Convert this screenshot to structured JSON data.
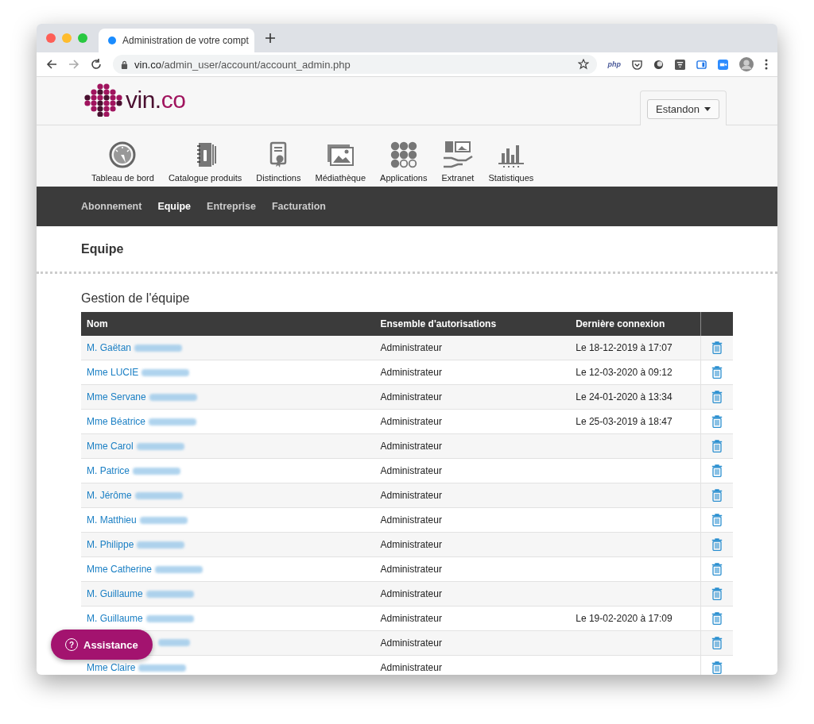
{
  "browser": {
    "tab_title": "Administration de votre compt",
    "url_host": "vin.co",
    "url_path": "/admin_user/account/account_admin.php",
    "extension_label": "php"
  },
  "header": {
    "logo_text": "vin.",
    "logo_accent": "co",
    "user_menu": "Estandon"
  },
  "modules": [
    {
      "label": "Tableau de bord",
      "kind": "gauge"
    },
    {
      "label": "Catalogue produits",
      "kind": "catalog"
    },
    {
      "label": "Distinctions",
      "kind": "award"
    },
    {
      "label": "Médiathèque",
      "kind": "images"
    },
    {
      "label": "Applications",
      "kind": "grid"
    },
    {
      "label": "Extranet",
      "kind": "hand"
    },
    {
      "label": "Statistiques",
      "kind": "chart"
    }
  ],
  "subnav": [
    {
      "label": "Abonnement",
      "selected": false
    },
    {
      "label": "Equipe",
      "selected": true
    },
    {
      "label": "Entreprise",
      "selected": false
    },
    {
      "label": "Facturation",
      "selected": false
    }
  ],
  "page_title": "Equipe",
  "section_title": "Gestion de l'équipe",
  "table": {
    "columns": [
      "Nom",
      "Ensemble d'autorisations",
      "Dernière connexion"
    ],
    "rows": [
      {
        "name": "M. Gaëtan",
        "surname_blurred": true,
        "role": "Administrateur",
        "last_login": "Le 18-12-2019 à 17:07"
      },
      {
        "name": "Mme LUCIE",
        "surname_blurred": true,
        "role": "Administrateur",
        "last_login": "Le 12-03-2020 à 09:12"
      },
      {
        "name": "Mme Servane",
        "surname_blurred": true,
        "role": "Administrateur",
        "last_login": "Le 24-01-2020 à 13:34"
      },
      {
        "name": "Mme Béatrice",
        "surname_blurred": true,
        "role": "Administrateur",
        "last_login": "Le 25-03-2019 à 18:47"
      },
      {
        "name": "Mme Carol",
        "surname_blurred": true,
        "role": "Administrateur"
      },
      {
        "name": "M. Patrice",
        "surname_blurred": true,
        "role": "Administrateur"
      },
      {
        "name": "M. Jérôme",
        "surname_blurred": true,
        "role": "Administrateur"
      },
      {
        "name": "M. Matthieu",
        "surname_blurred": true,
        "role": "Administrateur"
      },
      {
        "name": "M. Philippe",
        "surname_blurred": true,
        "role": "Administrateur"
      },
      {
        "name": "Mme Catherine",
        "surname_blurred": true,
        "role": "Administrateur"
      },
      {
        "name": "M. Guillaume",
        "surname_blurred": true,
        "role": "Administrateur"
      },
      {
        "name": "M. Guillaume",
        "surname_blurred": true,
        "role": "Administrateur",
        "last_login": "Le 19-02-2020 à 17:09"
      },
      {
        "surname_blurred": true,
        "role": "Administrateur"
      },
      {
        "name": "Mme Claire",
        "surname_blurred": true,
        "role": "Administrateur"
      }
    ]
  },
  "assistance_button": "Assistance",
  "assistance_icon": "?"
}
